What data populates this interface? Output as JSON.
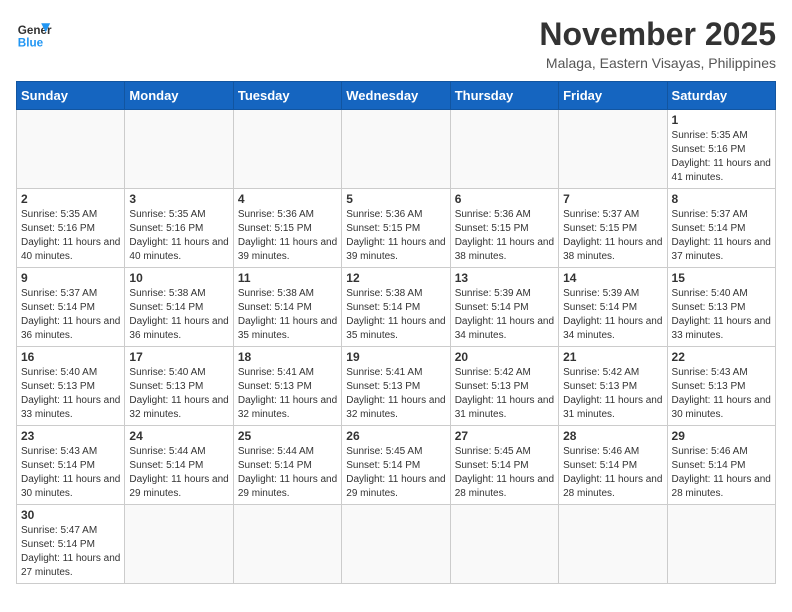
{
  "header": {
    "logo_general": "General",
    "logo_blue": "Blue",
    "month_title": "November 2025",
    "location": "Malaga, Eastern Visayas, Philippines"
  },
  "days_of_week": [
    "Sunday",
    "Monday",
    "Tuesday",
    "Wednesday",
    "Thursday",
    "Friday",
    "Saturday"
  ],
  "weeks": [
    [
      {
        "day": "",
        "info": ""
      },
      {
        "day": "",
        "info": ""
      },
      {
        "day": "",
        "info": ""
      },
      {
        "day": "",
        "info": ""
      },
      {
        "day": "",
        "info": ""
      },
      {
        "day": "",
        "info": ""
      },
      {
        "day": "1",
        "info": "Sunrise: 5:35 AM\nSunset: 5:16 PM\nDaylight: 11 hours and 41 minutes."
      }
    ],
    [
      {
        "day": "2",
        "info": "Sunrise: 5:35 AM\nSunset: 5:16 PM\nDaylight: 11 hours and 40 minutes."
      },
      {
        "day": "3",
        "info": "Sunrise: 5:35 AM\nSunset: 5:16 PM\nDaylight: 11 hours and 40 minutes."
      },
      {
        "day": "4",
        "info": "Sunrise: 5:36 AM\nSunset: 5:15 PM\nDaylight: 11 hours and 39 minutes."
      },
      {
        "day": "5",
        "info": "Sunrise: 5:36 AM\nSunset: 5:15 PM\nDaylight: 11 hours and 39 minutes."
      },
      {
        "day": "6",
        "info": "Sunrise: 5:36 AM\nSunset: 5:15 PM\nDaylight: 11 hours and 38 minutes."
      },
      {
        "day": "7",
        "info": "Sunrise: 5:37 AM\nSunset: 5:15 PM\nDaylight: 11 hours and 38 minutes."
      },
      {
        "day": "8",
        "info": "Sunrise: 5:37 AM\nSunset: 5:14 PM\nDaylight: 11 hours and 37 minutes."
      }
    ],
    [
      {
        "day": "9",
        "info": "Sunrise: 5:37 AM\nSunset: 5:14 PM\nDaylight: 11 hours and 36 minutes."
      },
      {
        "day": "10",
        "info": "Sunrise: 5:38 AM\nSunset: 5:14 PM\nDaylight: 11 hours and 36 minutes."
      },
      {
        "day": "11",
        "info": "Sunrise: 5:38 AM\nSunset: 5:14 PM\nDaylight: 11 hours and 35 minutes."
      },
      {
        "day": "12",
        "info": "Sunrise: 5:38 AM\nSunset: 5:14 PM\nDaylight: 11 hours and 35 minutes."
      },
      {
        "day": "13",
        "info": "Sunrise: 5:39 AM\nSunset: 5:14 PM\nDaylight: 11 hours and 34 minutes."
      },
      {
        "day": "14",
        "info": "Sunrise: 5:39 AM\nSunset: 5:14 PM\nDaylight: 11 hours and 34 minutes."
      },
      {
        "day": "15",
        "info": "Sunrise: 5:40 AM\nSunset: 5:13 PM\nDaylight: 11 hours and 33 minutes."
      }
    ],
    [
      {
        "day": "16",
        "info": "Sunrise: 5:40 AM\nSunset: 5:13 PM\nDaylight: 11 hours and 33 minutes."
      },
      {
        "day": "17",
        "info": "Sunrise: 5:40 AM\nSunset: 5:13 PM\nDaylight: 11 hours and 32 minutes."
      },
      {
        "day": "18",
        "info": "Sunrise: 5:41 AM\nSunset: 5:13 PM\nDaylight: 11 hours and 32 minutes."
      },
      {
        "day": "19",
        "info": "Sunrise: 5:41 AM\nSunset: 5:13 PM\nDaylight: 11 hours and 32 minutes."
      },
      {
        "day": "20",
        "info": "Sunrise: 5:42 AM\nSunset: 5:13 PM\nDaylight: 11 hours and 31 minutes."
      },
      {
        "day": "21",
        "info": "Sunrise: 5:42 AM\nSunset: 5:13 PM\nDaylight: 11 hours and 31 minutes."
      },
      {
        "day": "22",
        "info": "Sunrise: 5:43 AM\nSunset: 5:13 PM\nDaylight: 11 hours and 30 minutes."
      }
    ],
    [
      {
        "day": "23",
        "info": "Sunrise: 5:43 AM\nSunset: 5:14 PM\nDaylight: 11 hours and 30 minutes."
      },
      {
        "day": "24",
        "info": "Sunrise: 5:44 AM\nSunset: 5:14 PM\nDaylight: 11 hours and 29 minutes."
      },
      {
        "day": "25",
        "info": "Sunrise: 5:44 AM\nSunset: 5:14 PM\nDaylight: 11 hours and 29 minutes."
      },
      {
        "day": "26",
        "info": "Sunrise: 5:45 AM\nSunset: 5:14 PM\nDaylight: 11 hours and 29 minutes."
      },
      {
        "day": "27",
        "info": "Sunrise: 5:45 AM\nSunset: 5:14 PM\nDaylight: 11 hours and 28 minutes."
      },
      {
        "day": "28",
        "info": "Sunrise: 5:46 AM\nSunset: 5:14 PM\nDaylight: 11 hours and 28 minutes."
      },
      {
        "day": "29",
        "info": "Sunrise: 5:46 AM\nSunset: 5:14 PM\nDaylight: 11 hours and 28 minutes."
      }
    ],
    [
      {
        "day": "30",
        "info": "Sunrise: 5:47 AM\nSunset: 5:14 PM\nDaylight: 11 hours and 27 minutes."
      },
      {
        "day": "",
        "info": ""
      },
      {
        "day": "",
        "info": ""
      },
      {
        "day": "",
        "info": ""
      },
      {
        "day": "",
        "info": ""
      },
      {
        "day": "",
        "info": ""
      },
      {
        "day": "",
        "info": ""
      }
    ]
  ]
}
